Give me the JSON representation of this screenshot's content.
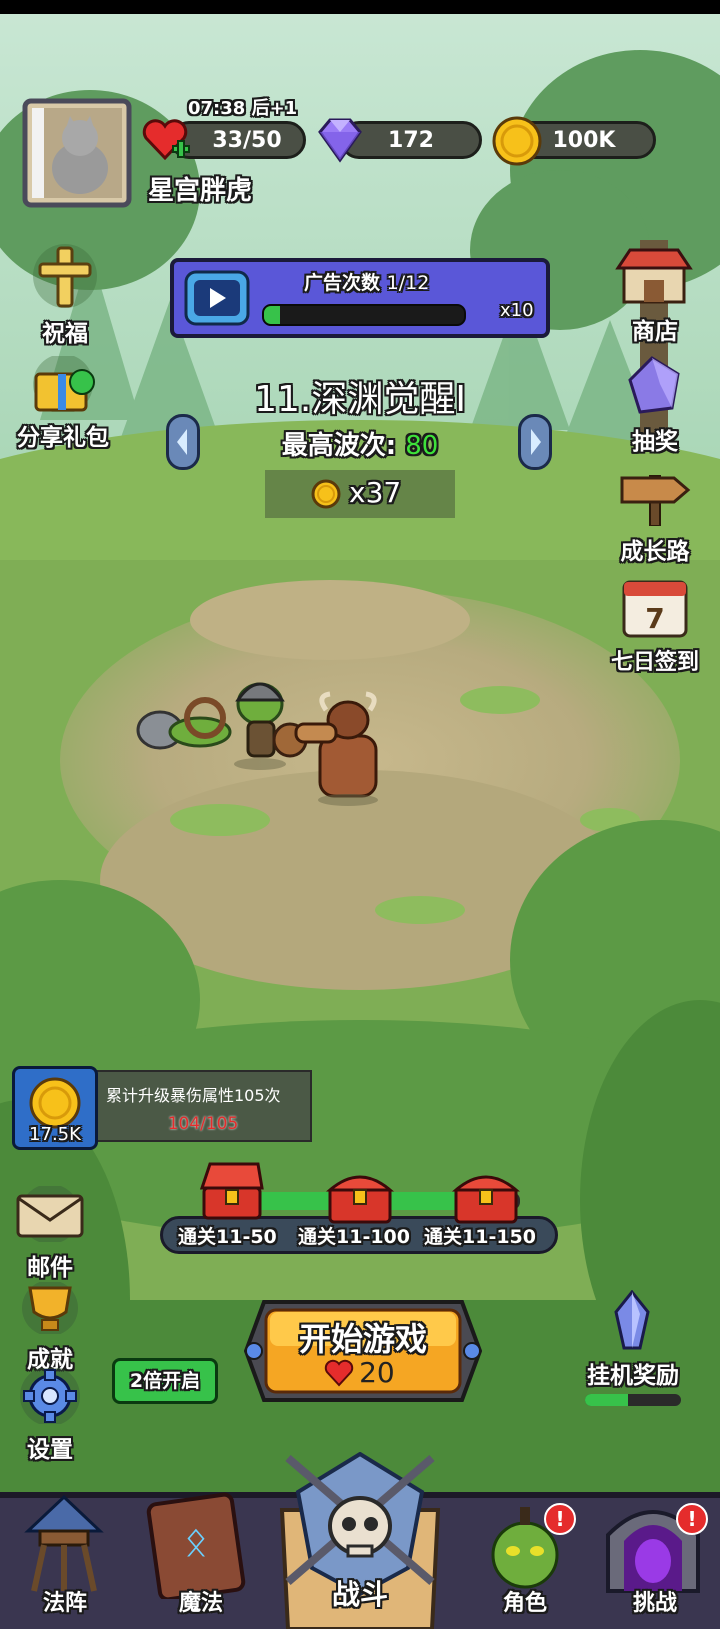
{
  "player": {
    "name": "星宫胖虎",
    "timer": "07:38",
    "timer_suffix": "后+1",
    "energy": "33/50",
    "gems": "172",
    "coins": "100K"
  },
  "left_buttons": {
    "blessing": "祝福",
    "share_gift": "分享礼包"
  },
  "right_buttons": {
    "shop": "商店",
    "lottery": "抽奖",
    "growth_path": "成长路",
    "checkin": "七日签到",
    "checkin_day": "7"
  },
  "ad_panel": {
    "label": "广告次数",
    "count": "1/12",
    "multiplier": "x10",
    "progress": 0.08
  },
  "stage": {
    "name": "11.深渊觉醒Ⅰ",
    "best_wave_label": "最高波次:",
    "best_wave_value": "80",
    "reward": "x37"
  },
  "task": {
    "desc": "累计升级暴伤属性105次",
    "progress_text": "104/105",
    "reward": "17.5K"
  },
  "chests": {
    "items": [
      "通关11-50",
      "通关11-100",
      "通关11-150"
    ],
    "progress": 0.85
  },
  "bottom_left": {
    "mail": "邮件",
    "achievement": "成就",
    "settings": "设置",
    "double_speed": "2倍开启"
  },
  "start": {
    "label": "开始游戏",
    "cost": "20"
  },
  "idle_reward": {
    "label": "挂机奖励",
    "progress": 0.45
  },
  "nav": {
    "formation": "法阵",
    "magic": "魔法",
    "battle": "战斗",
    "hero": "角色",
    "challenge": "挑战",
    "badge": "!"
  },
  "colors": {
    "accent_green": "#37c24a",
    "highlight_green": "#3ee23a",
    "gold": "#f7c11a",
    "red": "#e52c2c",
    "ad_purple": "#5a57d8"
  }
}
